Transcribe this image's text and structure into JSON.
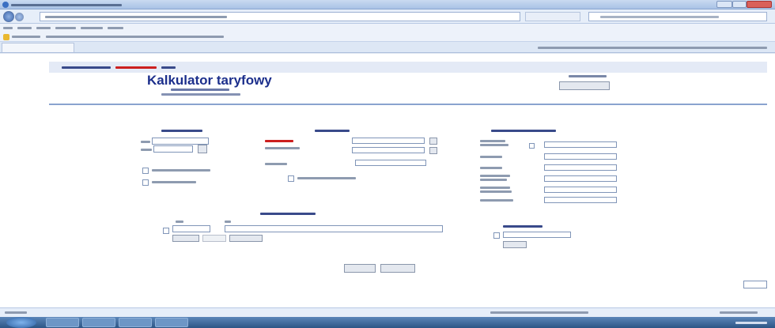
{
  "page": {
    "title": "Kalkulator taryfowy",
    "date_label": "",
    "hour_label": "",
    "steps_line": ""
  },
  "sections": {
    "dane_zgloszenia": "",
    "dane_pozycji": "",
    "elementy": "",
    "jednostki": "",
    "kody": ""
  },
  "colors": {
    "accent": "#1c2f8c",
    "highlight": "#cc1f1f",
    "banner": "#e4eaf6"
  }
}
